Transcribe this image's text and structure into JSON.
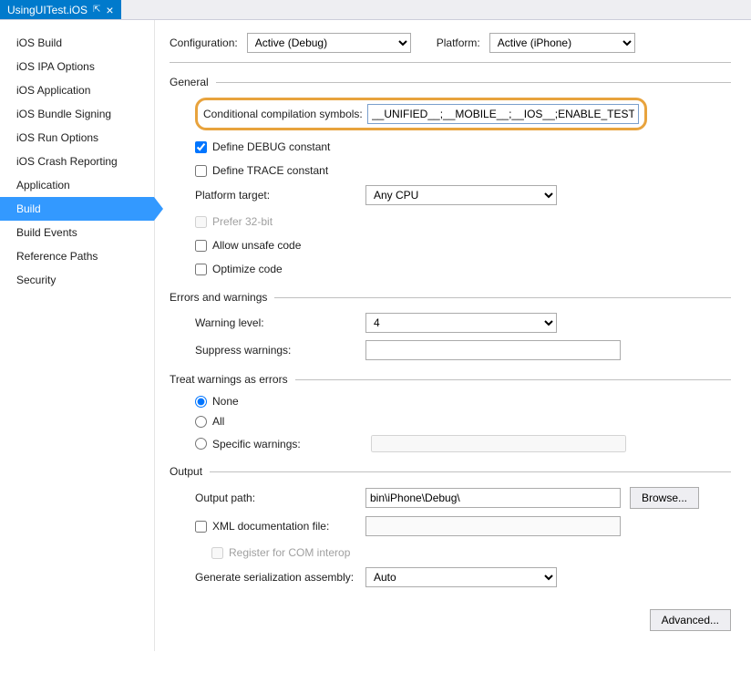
{
  "tab": {
    "title": "UsingUITest.iOS"
  },
  "sidebar": {
    "items": [
      "iOS Build",
      "iOS IPA Options",
      "iOS Application",
      "iOS Bundle Signing",
      "iOS Run Options",
      "iOS Crash Reporting",
      "Application",
      "Build",
      "Build Events",
      "Reference Paths",
      "Security"
    ],
    "selectedIndex": 7
  },
  "toprow": {
    "config_label": "Configuration:",
    "config_value": "Active (Debug)",
    "platform_label": "Platform:",
    "platform_value": "Active (iPhone)"
  },
  "general": {
    "title": "General",
    "cond_label": "Conditional compilation symbols:",
    "cond_value": "__UNIFIED__;__MOBILE__;__IOS__;ENABLE_TEST_CLOUD;",
    "define_debug": "Define DEBUG constant",
    "define_trace": "Define TRACE constant",
    "platform_target_label": "Platform target:",
    "platform_target_value": "Any CPU",
    "prefer_32": "Prefer 32-bit",
    "allow_unsafe": "Allow unsafe code",
    "optimize": "Optimize code"
  },
  "errors": {
    "title": "Errors and warnings",
    "warning_level_label": "Warning level:",
    "warning_level_value": "4",
    "suppress_label": "Suppress warnings:",
    "suppress_value": ""
  },
  "treat": {
    "title": "Treat warnings as errors",
    "none": "None",
    "all": "All",
    "specific": "Specific warnings:",
    "specific_value": ""
  },
  "output": {
    "title": "Output",
    "path_label": "Output path:",
    "path_value": "bin\\iPhone\\Debug\\",
    "browse": "Browse...",
    "xml_doc": "XML documentation file:",
    "xml_value": "",
    "register_com": "Register for COM interop",
    "gen_serial_label": "Generate serialization assembly:",
    "gen_serial_value": "Auto"
  },
  "advanced": "Advanced..."
}
